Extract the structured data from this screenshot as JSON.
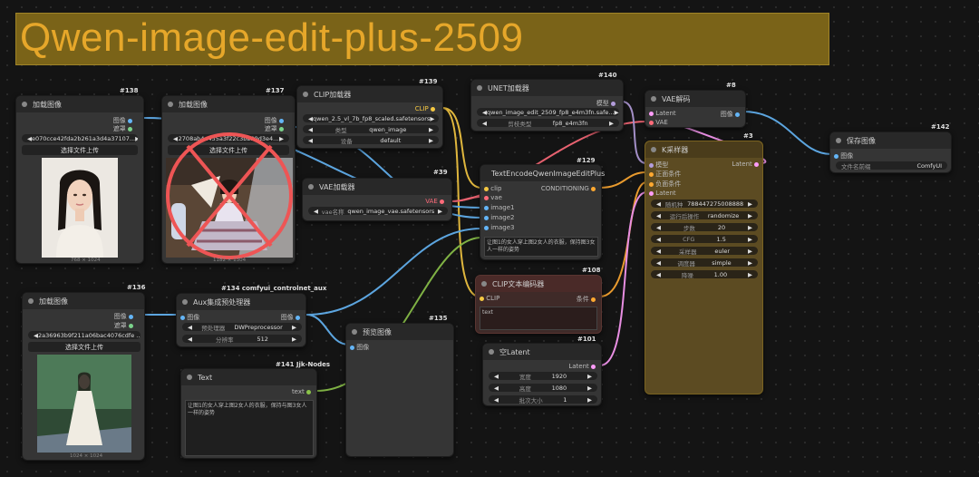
{
  "canvas": {
    "title": "Qwen-image-edit-plus-2509"
  },
  "nodes": {
    "n138": {
      "id": "#138",
      "title": "加载图像",
      "outputs": [
        "图像",
        "遮罩"
      ],
      "file": "e070cce42fda2b261a3d4a37107...",
      "upload": "选择文件上传",
      "caption": "768 × 1024"
    },
    "n137": {
      "id": "#137",
      "title": "加载图像",
      "outputs": [
        "图像",
        "遮罩"
      ],
      "file": "2708ab4a455a3f22c3bb39d3e4...",
      "upload": "选择文件上传",
      "caption": "1182 × 1304"
    },
    "n139": {
      "id": "#139",
      "title": "CLIP加载器",
      "output": "CLIP",
      "widgets": [
        {
          "label": "",
          "value": "qwen_2.5_vl_7b_fp8_scaled.safetensors"
        },
        {
          "label": "类型",
          "value": "qwen_image"
        },
        {
          "label": "设备",
          "value": "default"
        }
      ]
    },
    "n39": {
      "id": "#39",
      "title": "VAE加载器",
      "output": "VAE",
      "widgets": [
        {
          "label": "vae名称",
          "value": "qwen_image_vae.safetensors"
        }
      ]
    },
    "n140": {
      "id": "#140",
      "title": "UNET加载器",
      "output": "模型",
      "widgets": [
        {
          "label": "",
          "value": "qwen_image_edit_2509_fp8_e4m3fn.safe..."
        },
        {
          "label": "剪枝类型",
          "value": "fp8_e4m3fn"
        }
      ]
    },
    "n129": {
      "id": "#129",
      "title": "TextEncodeQwenImageEditPlus",
      "inputs": [
        "clip",
        "vae",
        "image1",
        "image2",
        "image3"
      ],
      "output": "CONDITIONING",
      "prompt": "让图1的女人穿上图2女人的衣服，保持图3女人一样的姿势"
    },
    "n8": {
      "id": "#8",
      "title": "VAE解码",
      "inputs": [
        "Latent",
        "VAE"
      ],
      "output": "图像"
    },
    "n3": {
      "id": "#3",
      "title": "K采样器",
      "inputs": [
        "模型",
        "正面条件",
        "负面条件",
        "Latent"
      ],
      "output": "Latent",
      "widgets": [
        {
          "label": "随机种",
          "value": "788447275008888"
        },
        {
          "label": "运行后操作",
          "value": "randomize"
        },
        {
          "label": "步数",
          "value": "20"
        },
        {
          "label": "CFG",
          "value": "1.5"
        },
        {
          "label": "采样器",
          "value": "euler"
        },
        {
          "label": "调度器",
          "value": "simple"
        },
        {
          "label": "降噪",
          "value": "1.00"
        }
      ]
    },
    "n142": {
      "id": "#142",
      "title": "保存图像",
      "input": "图像",
      "widgets": [
        {
          "label": "文件名前缀",
          "value": "ComfyUI"
        }
      ]
    },
    "n136": {
      "id": "#136",
      "title": "加载图像",
      "outputs": [
        "图像",
        "遮罩"
      ],
      "file": "2a36963b9f211a06bac4076cdfe ...",
      "upload": "选择文件上传",
      "caption": "1024 × 1024"
    },
    "n134": {
      "id": "#134 comfyui_controlnet_aux",
      "title": "Aux集成预处理器",
      "input": "图像",
      "output": "图像",
      "widgets": [
        {
          "label": "预处理器",
          "value": "DWPreprocessor"
        },
        {
          "label": "分辨率",
          "value": "512"
        }
      ]
    },
    "n135": {
      "id": "#135",
      "title": "预览图像",
      "input": "图像"
    },
    "n141": {
      "id": "#141 Jjk-Nodes",
      "title": "Text",
      "output": "text",
      "text": "让图1的女人穿上图2女人的衣服，保持与图3女人一样的姿势"
    },
    "n108": {
      "id": "#108",
      "title": "CLIP文本编码器",
      "input": "CLIP",
      "output": "条件",
      "text": "text"
    },
    "n101": {
      "id": "#101",
      "title": "空Latent",
      "output": "Latent",
      "widgets": [
        {
          "label": "宽度",
          "value": "1920"
        },
        {
          "label": "高度",
          "value": "1080"
        },
        {
          "label": "批次大小",
          "value": "1"
        }
      ]
    }
  },
  "colors": {
    "clip": "#f5c842",
    "vae": "#ff6b7a",
    "image": "#64b5f6",
    "conditioning": "#ffa931",
    "latent": "#ff9cf9",
    "model": "#b39ddb",
    "text": "#8bc34a"
  }
}
